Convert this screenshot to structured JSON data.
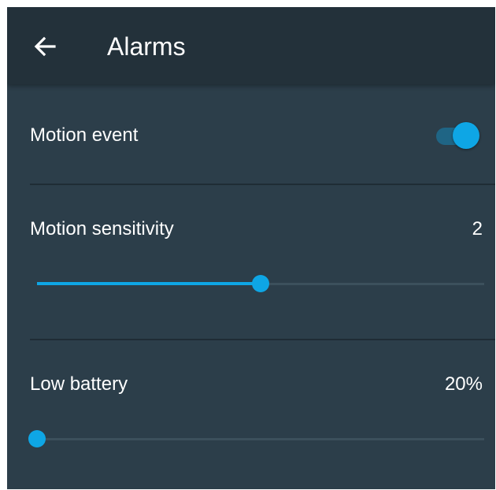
{
  "app_bar": {
    "back_icon": "arrow-left-icon",
    "title": "Alarms"
  },
  "settings": {
    "motion_event": {
      "label": "Motion event",
      "enabled": true
    },
    "motion_sensitivity": {
      "label": "Motion sensitivity",
      "value": "2",
      "fraction": 0.5
    },
    "low_battery": {
      "label": "Low battery",
      "value": "20%",
      "fraction": 0.0
    }
  },
  "colors": {
    "accent": "#0ea6e5",
    "background": "#2c3e4a",
    "app_bar": "#23313a"
  }
}
